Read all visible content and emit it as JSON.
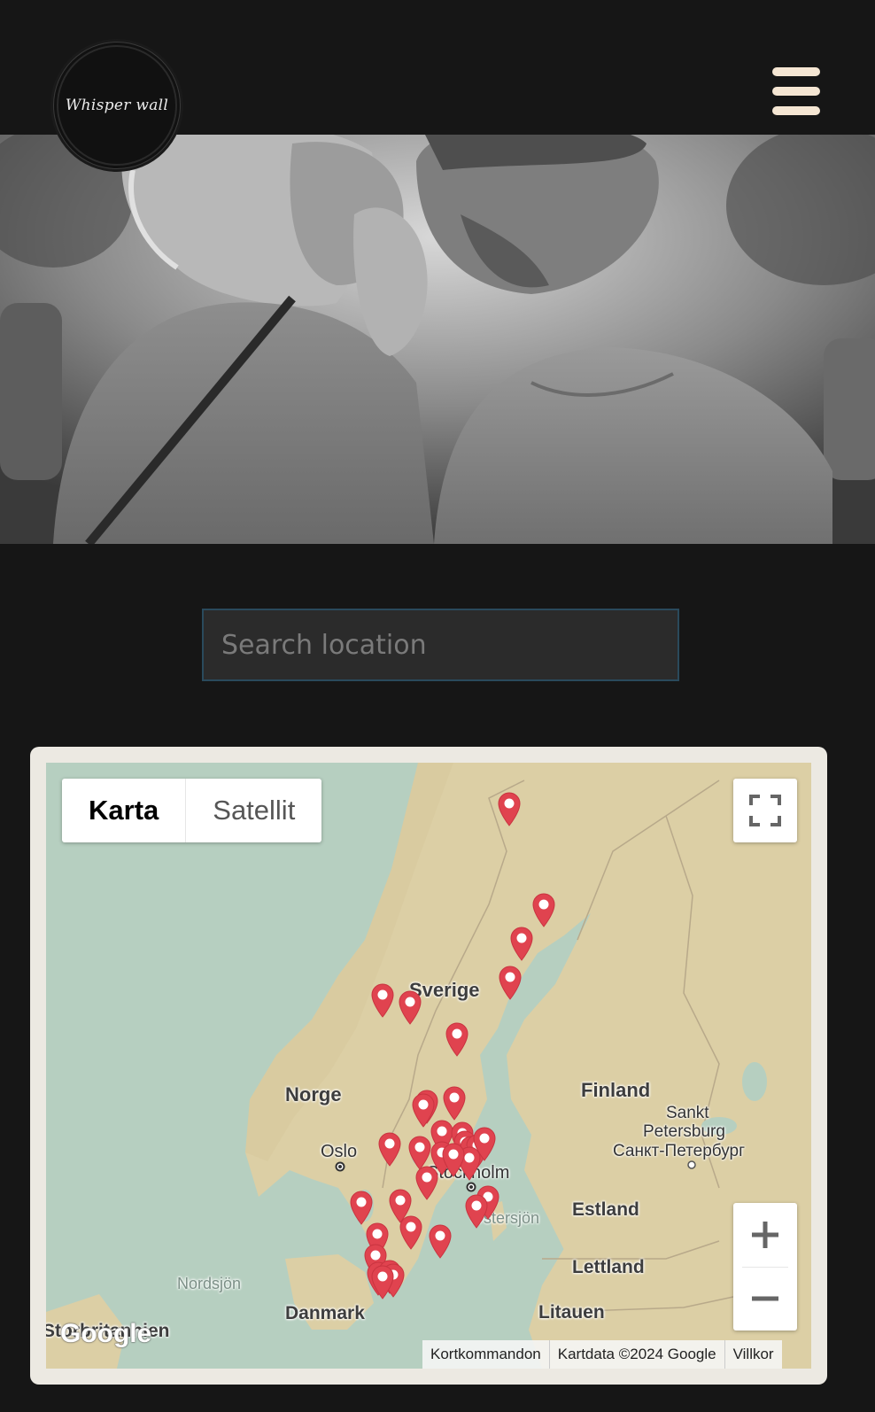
{
  "header": {
    "logo_text": "Whisper wall",
    "menu_icon": "hamburger-icon",
    "menu_color": "#f5e6d3"
  },
  "search": {
    "placeholder": "Search location",
    "value": ""
  },
  "map": {
    "map_type": {
      "map_label": "Karta",
      "satellite_label": "Satellit",
      "selected": "Karta"
    },
    "fullscreen_icon": "fullscreen-icon",
    "zoom_in_icon": "plus-icon",
    "zoom_out_icon": "minus-icon",
    "labels": {
      "sverige": "Sverige",
      "norge": "Norge",
      "finland": "Finland",
      "sankt": "Sankt",
      "petersburg": "Petersburg",
      "petersburg_ru": "Санкт-Петербург",
      "oslo": "Oslo",
      "stockholm": "Stockholm",
      "ostersjon": "Östersjön",
      "estland": "Estland",
      "lettland": "Lettland",
      "litauen": "Litauen",
      "nordsjon": "Nordsjön",
      "danmark": "Danmark",
      "storbritannien": "Storbritannien"
    },
    "google_logo": "Google",
    "attribution": {
      "shortcuts": "Kortkommandon",
      "data": "Kartdata ©2024 Google",
      "terms": "Villkor"
    },
    "marker_color": "#e0434f",
    "marker_count": 34
  }
}
